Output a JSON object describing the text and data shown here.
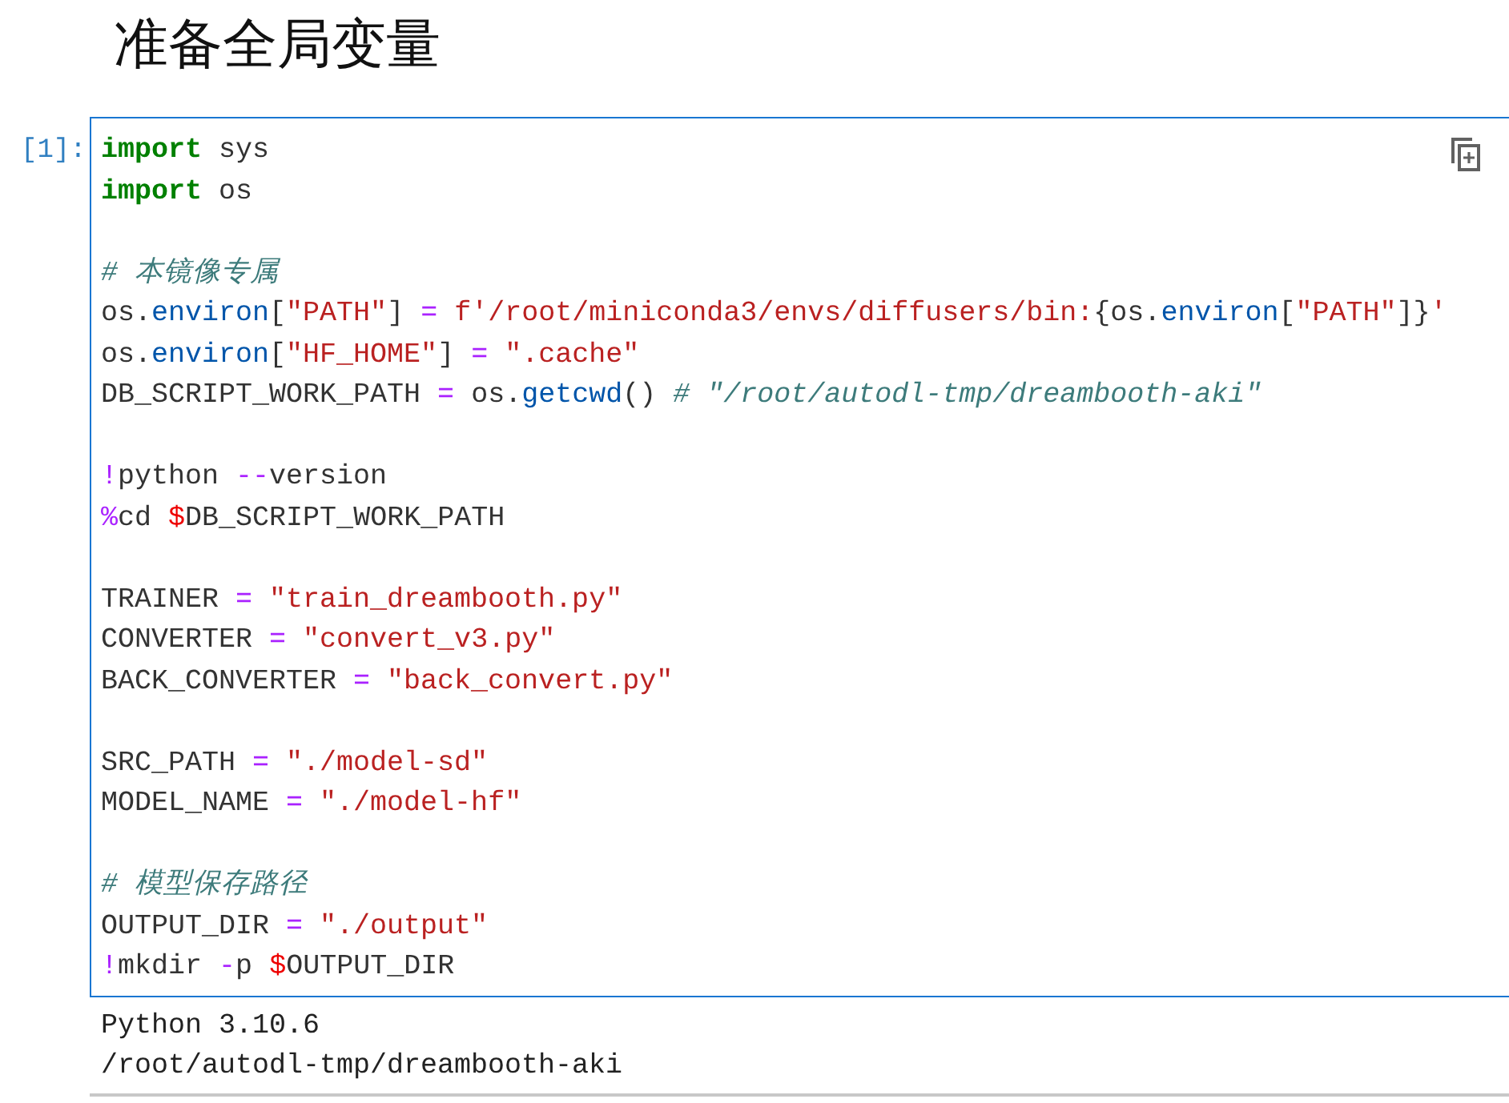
{
  "heading": "准备全局变量",
  "cell": {
    "prompt": "[1]:",
    "selected": true,
    "lines": [
      {
        "kind": "code",
        "tokens": [
          {
            "kind": "keyword",
            "text": "import"
          },
          {
            "kind": "name",
            "text": " sys"
          }
        ]
      },
      {
        "kind": "code",
        "tokens": [
          {
            "kind": "keyword",
            "text": "import"
          },
          {
            "kind": "name",
            "text": " os"
          }
        ]
      },
      {
        "kind": "blank"
      },
      {
        "kind": "code",
        "tokens": [
          {
            "kind": "comment",
            "text": "# 本镜像专属"
          }
        ]
      },
      {
        "kind": "code",
        "tokens": [
          {
            "kind": "name",
            "text": "os."
          },
          {
            "kind": "attr",
            "text": "environ"
          },
          {
            "kind": "name",
            "text": "["
          },
          {
            "kind": "string",
            "text": "\"PATH\""
          },
          {
            "kind": "name",
            "text": "] "
          },
          {
            "kind": "operator",
            "text": "= "
          },
          {
            "kind": "string",
            "text": "f'/root/miniconda3/envs/diffusers/bin:"
          },
          {
            "kind": "name",
            "text": "{os."
          },
          {
            "kind": "attr",
            "text": "environ"
          },
          {
            "kind": "name",
            "text": "["
          },
          {
            "kind": "string",
            "text": "\"PATH\""
          },
          {
            "kind": "name",
            "text": "]}"
          },
          {
            "kind": "string",
            "text": "'"
          }
        ]
      },
      {
        "kind": "code",
        "tokens": [
          {
            "kind": "name",
            "text": "os."
          },
          {
            "kind": "attr",
            "text": "environ"
          },
          {
            "kind": "name",
            "text": "["
          },
          {
            "kind": "string",
            "text": "\"HF_HOME\""
          },
          {
            "kind": "name",
            "text": "] "
          },
          {
            "kind": "operator",
            "text": "= "
          },
          {
            "kind": "string",
            "text": "\".cache\""
          }
        ]
      },
      {
        "kind": "code",
        "tokens": [
          {
            "kind": "name",
            "text": "DB_SCRIPT_WORK_PATH "
          },
          {
            "kind": "operator",
            "text": "="
          },
          {
            "kind": "name",
            "text": " os."
          },
          {
            "kind": "attr",
            "text": "getcwd"
          },
          {
            "kind": "name",
            "text": "() "
          },
          {
            "kind": "comment",
            "text": "# \"/root/autodl-tmp/dreambooth-aki\""
          }
        ]
      },
      {
        "kind": "blank"
      },
      {
        "kind": "code",
        "tokens": [
          {
            "kind": "operator",
            "text": "!"
          },
          {
            "kind": "name",
            "text": "python "
          },
          {
            "kind": "operator",
            "text": "--"
          },
          {
            "kind": "name",
            "text": "version"
          }
        ]
      },
      {
        "kind": "code",
        "tokens": [
          {
            "kind": "operator",
            "text": "%"
          },
          {
            "kind": "name",
            "text": "cd "
          },
          {
            "kind": "variable",
            "text": "$"
          },
          {
            "kind": "name",
            "text": "DB_SCRIPT_WORK_PATH"
          }
        ]
      },
      {
        "kind": "blank"
      },
      {
        "kind": "code",
        "tokens": [
          {
            "kind": "name",
            "text": "TRAINER "
          },
          {
            "kind": "operator",
            "text": "= "
          },
          {
            "kind": "string",
            "text": "\"train_dreambooth.py\""
          }
        ]
      },
      {
        "kind": "code",
        "tokens": [
          {
            "kind": "name",
            "text": "CONVERTER "
          },
          {
            "kind": "operator",
            "text": "= "
          },
          {
            "kind": "string",
            "text": "\"convert_v3.py\""
          }
        ]
      },
      {
        "kind": "code",
        "tokens": [
          {
            "kind": "name",
            "text": "BACK_CONVERTER "
          },
          {
            "kind": "operator",
            "text": "= "
          },
          {
            "kind": "string",
            "text": "\"back_convert.py\""
          }
        ]
      },
      {
        "kind": "blank"
      },
      {
        "kind": "code",
        "tokens": [
          {
            "kind": "name",
            "text": "SRC_PATH "
          },
          {
            "kind": "operator",
            "text": "= "
          },
          {
            "kind": "string",
            "text": "\"./model-sd\""
          }
        ]
      },
      {
        "kind": "code",
        "tokens": [
          {
            "kind": "name",
            "text": "MODEL_NAME "
          },
          {
            "kind": "operator",
            "text": "= "
          },
          {
            "kind": "string",
            "text": "\"./model-hf\""
          }
        ]
      },
      {
        "kind": "blank"
      },
      {
        "kind": "code",
        "tokens": [
          {
            "kind": "comment",
            "text": "# 模型保存路径"
          }
        ]
      },
      {
        "kind": "code",
        "tokens": [
          {
            "kind": "name",
            "text": "OUTPUT_DIR "
          },
          {
            "kind": "operator",
            "text": "= "
          },
          {
            "kind": "string",
            "text": "\"./output\""
          }
        ]
      },
      {
        "kind": "code",
        "tokens": [
          {
            "kind": "operator",
            "text": "!"
          },
          {
            "kind": "name",
            "text": "mkdir "
          },
          {
            "kind": "operator",
            "text": "-"
          },
          {
            "kind": "name",
            "text": "p "
          },
          {
            "kind": "variable",
            "text": "$"
          },
          {
            "kind": "name",
            "text": "OUTPUT_DIR"
          }
        ]
      }
    ],
    "output": [
      "Python 3.10.6",
      "/root/autodl-tmp/dreambooth-aki"
    ]
  }
}
